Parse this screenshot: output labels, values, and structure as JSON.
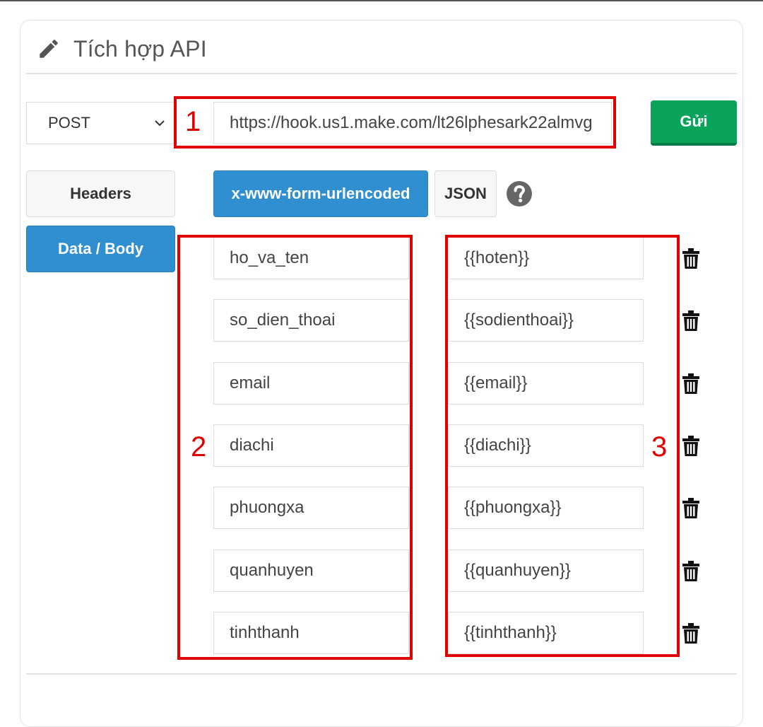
{
  "header": {
    "title": "Tích hợp API",
    "icon": "pencil-icon"
  },
  "request": {
    "method": "POST",
    "url": "https://hook.us1.make.com/lt26lphesark22almvg",
    "send_label": "Gửi"
  },
  "side_tabs": {
    "headers_label": "Headers",
    "body_label": "Data / Body",
    "active": "Data / Body"
  },
  "format_tabs": {
    "urlencoded_label": "x-www-form-urlencoded",
    "json_label": "JSON",
    "active": "x-www-form-urlencoded"
  },
  "fields": [
    {
      "key": "ho_va_ten",
      "value": "{{hoten}}"
    },
    {
      "key": "so_dien_thoai",
      "value": "{{sodienthoai}}"
    },
    {
      "key": "email",
      "value": "{{email}}"
    },
    {
      "key": "diachi",
      "value": "{{diachi}}"
    },
    {
      "key": "phuongxa",
      "value": "{{phuongxa}}"
    },
    {
      "key": "quanhuyen",
      "value": "{{quanhuyen}}"
    },
    {
      "key": "tinhthanh",
      "value": "{{tinhthanh}}"
    }
  ],
  "annotations": {
    "one": "1",
    "two": "2",
    "three": "3"
  },
  "colors": {
    "primary": "#2f8fd1",
    "success": "#0aa35a",
    "annotation": "#e00000"
  }
}
